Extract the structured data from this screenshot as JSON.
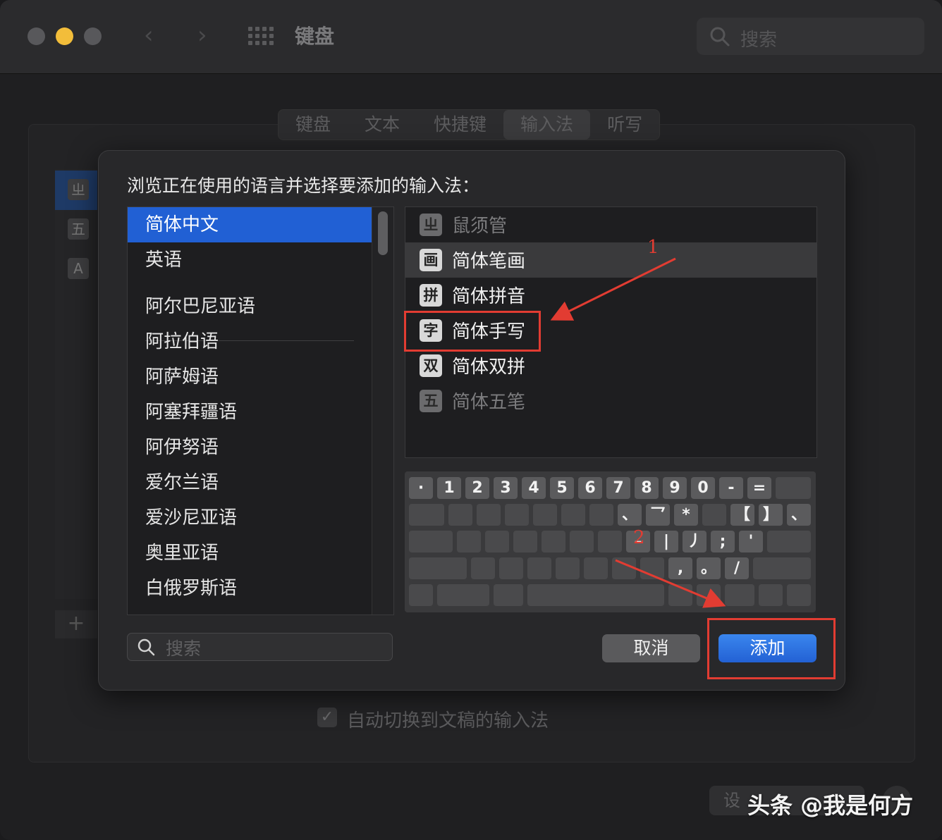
{
  "window": {
    "title": "键盘",
    "search_placeholder": "搜索",
    "tabs": [
      "键盘",
      "文本",
      "快捷键",
      "输入法",
      "听写"
    ],
    "active_tab": "输入法",
    "background": {
      "source_icons": [
        "ㄓ",
        "五",
        "A"
      ],
      "add_label": "+",
      "auto_switch_label": "自动切换到文稿的输入法",
      "auto_switch_checked": true,
      "bottom_button_label": "设"
    }
  },
  "sheet": {
    "prompt": "浏览正在使用的语言并选择要添加的输入法：",
    "languages": [
      {
        "label": "简体中文",
        "selected": true
      },
      {
        "label": "英语",
        "selected": false
      },
      {
        "label": "阿尔巴尼亚语",
        "selected": false
      },
      {
        "label": "阿拉伯语",
        "selected": false
      },
      {
        "label": "阿萨姆语",
        "selected": false
      },
      {
        "label": "阿塞拜疆语",
        "selected": false
      },
      {
        "label": "阿伊努语",
        "selected": false
      },
      {
        "label": "爱尔兰语",
        "selected": false
      },
      {
        "label": "爱沙尼亚语",
        "selected": false
      },
      {
        "label": "奥里亚语",
        "selected": false
      },
      {
        "label": "白俄罗斯语",
        "selected": false
      }
    ],
    "input_methods": [
      {
        "icon": "ㄓ",
        "label": "鼠须管",
        "state": "disabled"
      },
      {
        "icon": "画",
        "label": "简体笔画",
        "state": "selected"
      },
      {
        "icon": "拼",
        "label": "简体拼音",
        "state": "normal"
      },
      {
        "icon": "字",
        "label": "简体手写",
        "state": "normal"
      },
      {
        "icon": "双",
        "label": "简体双拼",
        "state": "normal"
      },
      {
        "icon": "五",
        "label": "简体五笔",
        "state": "disabled"
      }
    ],
    "keyboard": {
      "row1": [
        "·",
        "1",
        "2",
        "3",
        "4",
        "5",
        "6",
        "7",
        "8",
        "9",
        "0",
        "-",
        "=",
        ""
      ],
      "row2": [
        "",
        "",
        "",
        "",
        "",
        "",
        "",
        "、",
        "乛",
        "*",
        "",
        "【",
        "】",
        "、"
      ],
      "row3": [
        "",
        "",
        "",
        "",
        "",
        "",
        "",
        "–",
        "|",
        "丿",
        ";",
        "'",
        ""
      ],
      "row4": [
        "",
        "",
        "",
        "",
        "",
        "",
        "",
        "",
        ",",
        "。",
        "/",
        ""
      ],
      "row5": [
        "",
        "",
        "",
        "",
        "",
        "",
        "",
        "",
        ""
      ]
    },
    "search_placeholder": "搜索",
    "cancel_label": "取消",
    "add_label": "添加"
  },
  "annotations": {
    "label_1": "1",
    "label_2": "2",
    "color": "#e23c32"
  },
  "watermark": "头条 @我是何方"
}
